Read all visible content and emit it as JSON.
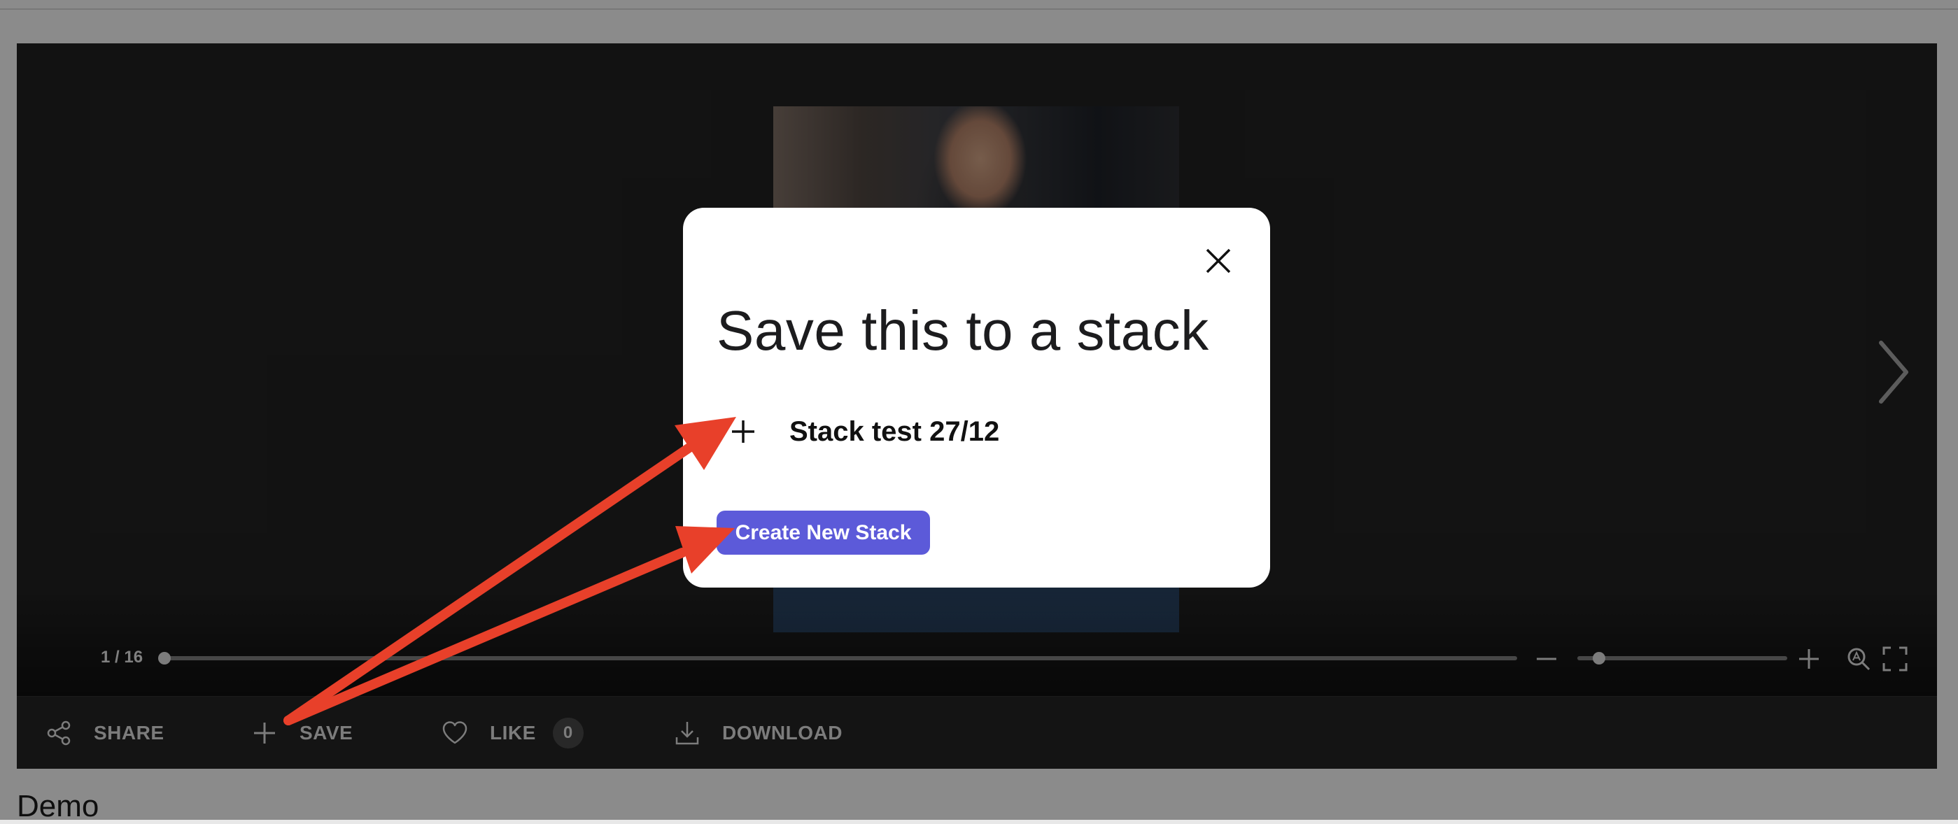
{
  "viewer": {
    "page_counter": "1 / 16",
    "progress_fraction": 0.0,
    "zoom_fraction": 0.1
  },
  "actions": {
    "share_label": "SHARE",
    "save_label": "SAVE",
    "like_label": "LIKE",
    "like_count": "0",
    "download_label": "DOWNLOAD"
  },
  "page": {
    "title": "Demo"
  },
  "modal": {
    "title": "Save this to a stack",
    "stacks": [
      {
        "name": "Stack test 27/12"
      }
    ],
    "create_button_label": "Create New Stack"
  },
  "colors": {
    "accent": "#5c5ad9",
    "annotation": "#e8402a",
    "viewer_bg": "#1f1f1f"
  },
  "icons": [
    "chevron-right-icon",
    "minus-icon",
    "plus-icon",
    "zoom-reset-icon",
    "fullscreen-icon",
    "share-icon",
    "heart-icon",
    "download-icon",
    "close-icon"
  ]
}
